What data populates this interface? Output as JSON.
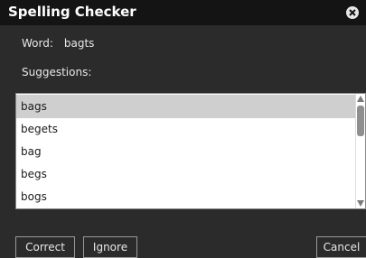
{
  "dialog": {
    "title": "Spelling Checker"
  },
  "word": {
    "label": "Word:",
    "value": "bagts"
  },
  "suggestions": {
    "label": "Suggestions:",
    "items": [
      {
        "text": "bags",
        "selected": true
      },
      {
        "text": "begets",
        "selected": false
      },
      {
        "text": "bag",
        "selected": false
      },
      {
        "text": "begs",
        "selected": false
      },
      {
        "text": "bogs",
        "selected": false
      }
    ]
  },
  "buttons": {
    "correct": "Correct",
    "ignore": "Ignore",
    "cancel": "Cancel"
  },
  "icons": {
    "close": "close-icon",
    "scroll_up": "arrow-up-icon",
    "scroll_down": "arrow-down-icon"
  },
  "colors": {
    "background": "#2b2b2b",
    "titlebar": "#141414",
    "selection": "#cfcfcf"
  }
}
